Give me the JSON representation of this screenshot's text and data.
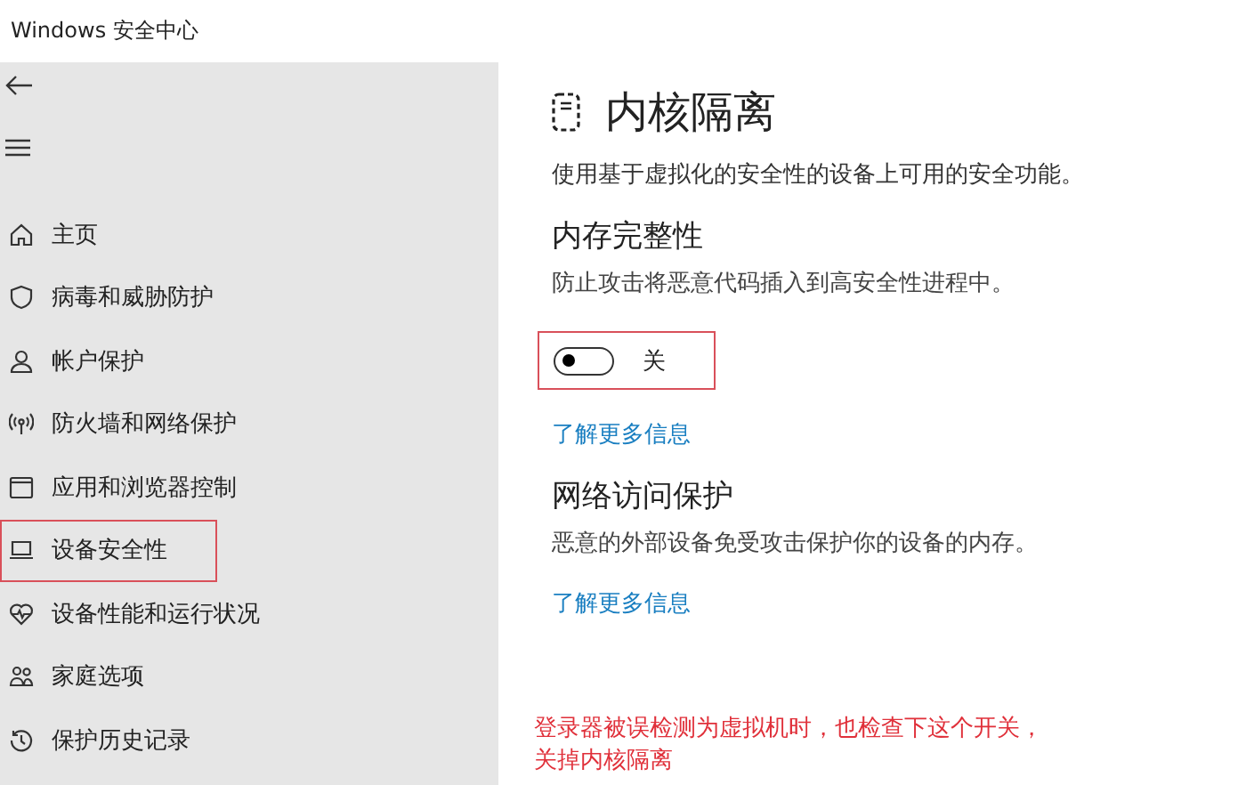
{
  "window": {
    "title": "Windows 安全中心"
  },
  "sidebar": {
    "items": [
      {
        "label": "主页",
        "annotated": false
      },
      {
        "label": "病毒和威胁防护",
        "annotated": false
      },
      {
        "label": "帐户保护",
        "annotated": false
      },
      {
        "label": "防火墙和网络保护",
        "annotated": false
      },
      {
        "label": "应用和浏览器控制",
        "annotated": false
      },
      {
        "label": "设备安全性",
        "annotated": true
      },
      {
        "label": "设备性能和运行状况",
        "annotated": false
      },
      {
        "label": "家庭选项",
        "annotated": false
      },
      {
        "label": "保护历史记录",
        "annotated": false
      }
    ]
  },
  "page": {
    "title": "内核隔离",
    "description": "使用基于虚拟化的安全性的设备上可用的安全功能。",
    "sections": [
      {
        "heading": "内存完整性",
        "description": "防止攻击将恶意代码插入到高安全性进程中。",
        "toggle": {
          "on": false,
          "label": "关",
          "annotated": true
        },
        "link": "了解更多信息"
      },
      {
        "heading": "网络访问保护",
        "description": "恶意的外部设备免受攻击保护你的设备的内存。",
        "link": "了解更多信息"
      }
    ]
  },
  "annotation": {
    "lines": [
      "登录器被误检测为虚拟机时，也检查下这个开关，",
      "关掉内核隔离"
    ]
  }
}
